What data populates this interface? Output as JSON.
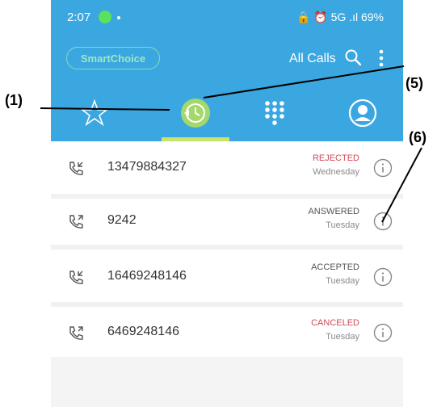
{
  "status_bar": {
    "time": "2:07",
    "right_icons": "🔒 ⏰ 5G .ıl 69%"
  },
  "header": {
    "smartchoice_label": "SmartChoice",
    "all_calls_label": "All Calls"
  },
  "tabs": [
    "favorites",
    "recents",
    "dialpad",
    "contacts"
  ],
  "calls": [
    {
      "number": "13479884327",
      "status": "REJECTED",
      "day": "Wednesday",
      "direction": "incoming",
      "status_color": "#d04a5a"
    },
    {
      "number": "9242",
      "status": "ANSWERED",
      "day": "Tuesday",
      "direction": "outgoing",
      "status_color": "#555555"
    },
    {
      "number": "16469248146",
      "status": "ACCEPTED",
      "day": "Tuesday",
      "direction": "incoming",
      "status_color": "#555555"
    },
    {
      "number": "6469248146",
      "status": "CANCELED",
      "day": "Tuesday",
      "direction": "outgoing",
      "status_color": "#d04a5a"
    }
  ],
  "annotations": {
    "a1": "(1)",
    "a5": "(5)",
    "a6": "(6)"
  },
  "colors": {
    "header": "#3aa7e0",
    "active_tab": "#c9e36b"
  }
}
